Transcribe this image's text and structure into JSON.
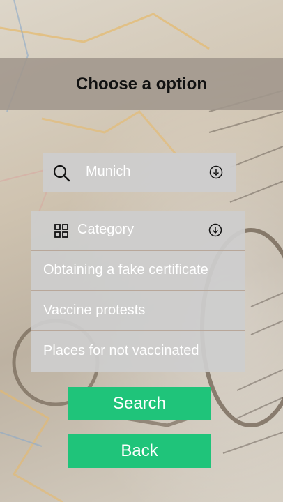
{
  "header": {
    "title": "Choose a option"
  },
  "location": {
    "value": "Munich",
    "icon": "search-icon",
    "dropdown_icon": "chevron-circle-down-icon"
  },
  "category": {
    "label": "Category",
    "icon": "grid-icon",
    "dropdown_icon": "chevron-circle-down-icon",
    "options": [
      "Obtaining a fake certificate",
      "Vaccine protests",
      "Places for not vaccinated"
    ]
  },
  "buttons": {
    "search_label": "Search",
    "back_label": "Back"
  },
  "colors": {
    "accent": "#1fc47a",
    "header_bg": "#a0968c",
    "panel_bg": "#cdcdcd"
  }
}
